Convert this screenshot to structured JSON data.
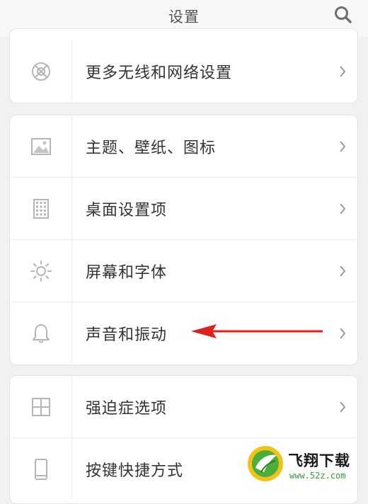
{
  "header": {
    "title": "设置",
    "search_icon": "search-icon"
  },
  "cards": [
    {
      "items": [
        {
          "label": "更多无线和网络设置",
          "icon": "wireless-icon"
        }
      ]
    },
    {
      "items": [
        {
          "label": "主题、壁纸、图标",
          "icon": "image-icon"
        },
        {
          "label": "桌面设置项",
          "icon": "grid-icon"
        },
        {
          "label": "屏幕和字体",
          "icon": "sun-icon"
        },
        {
          "label": "声音和振动",
          "icon": "bell-icon"
        }
      ]
    },
    {
      "items": [
        {
          "label": "强迫症选项",
          "icon": "square-grid-icon"
        },
        {
          "label": "按键快捷方式",
          "icon": "phone-icon"
        }
      ]
    }
  ],
  "annotation": {
    "color": "#e0201b",
    "target": "声音和振动"
  },
  "watermark": {
    "brand": "飞翔下载",
    "site": "www.52z.com"
  }
}
